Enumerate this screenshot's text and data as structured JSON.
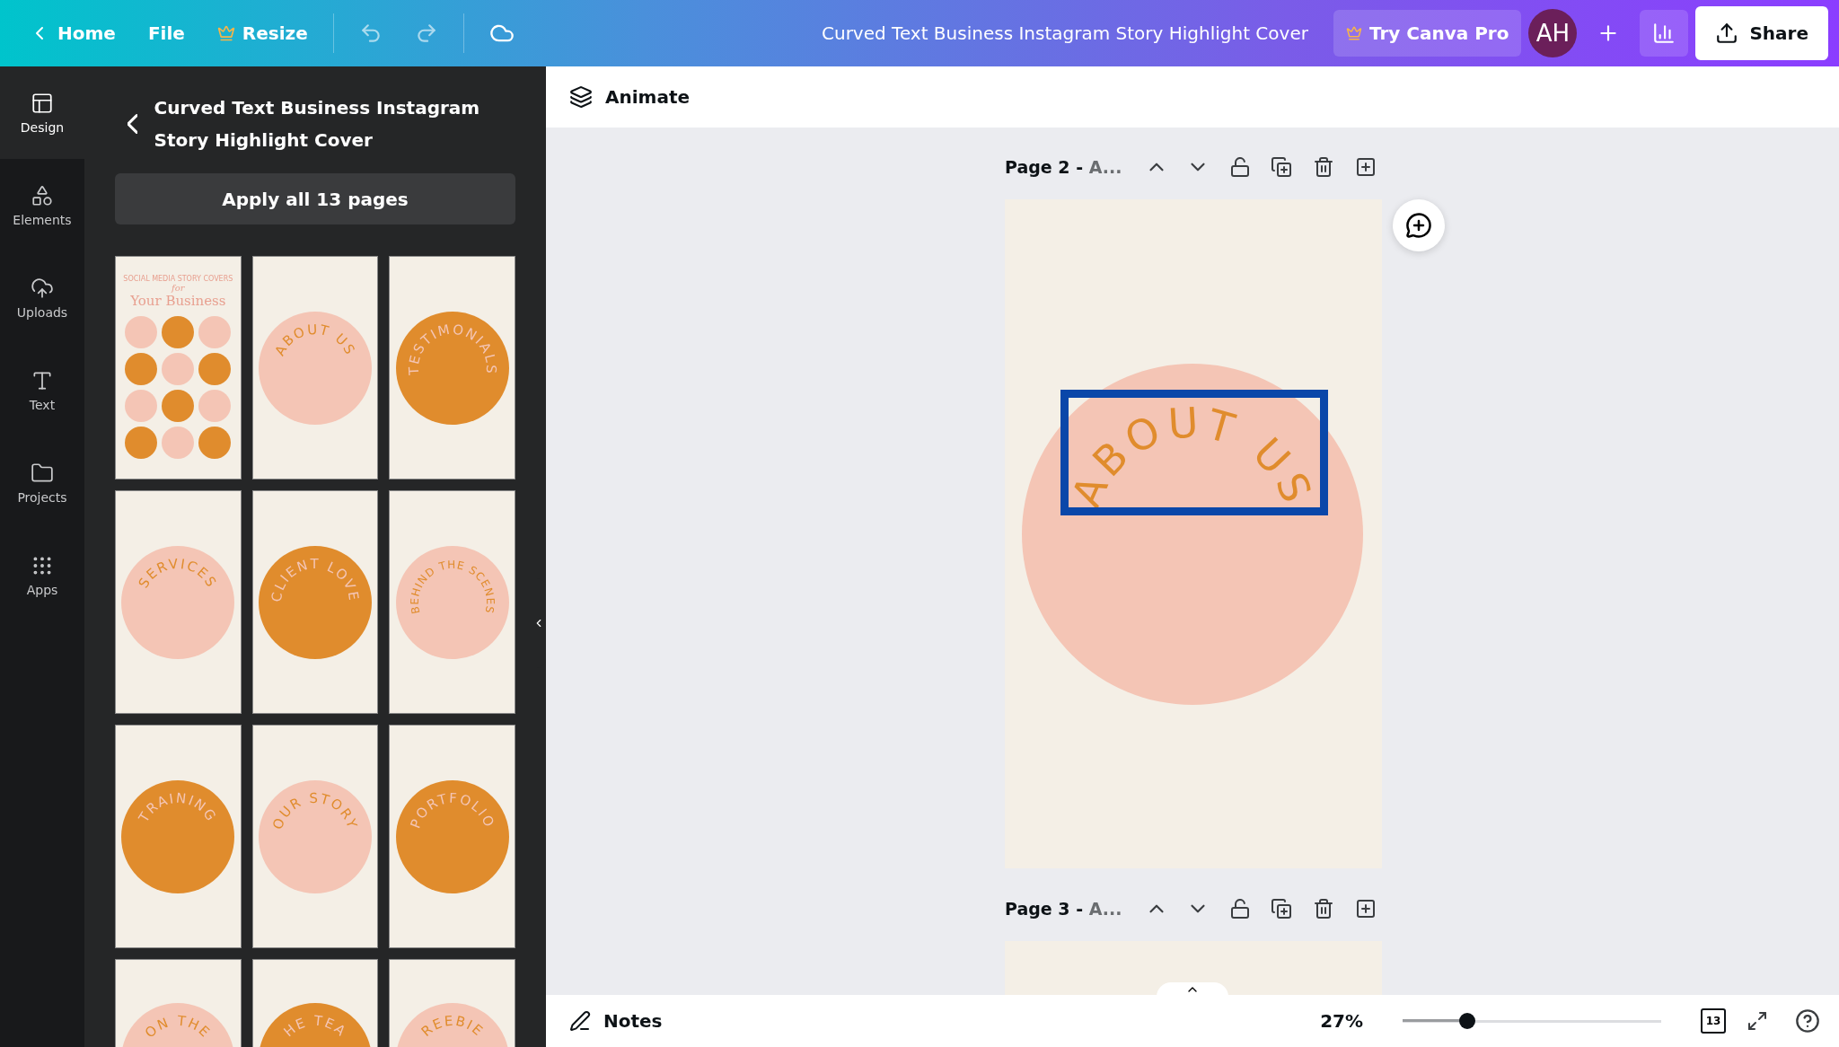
{
  "topbar": {
    "home": "Home",
    "file": "File",
    "resize": "Resize",
    "title": "Curved Text Business Instagram Story Highlight Cover",
    "pro": "Try Canva Pro",
    "avatar": "AH",
    "share": "Share"
  },
  "rail": [
    {
      "label": "Design",
      "selected": true
    },
    {
      "label": "Elements",
      "selected": false
    },
    {
      "label": "Uploads",
      "selected": false
    },
    {
      "label": "Text",
      "selected": false
    },
    {
      "label": "Projects",
      "selected": false
    },
    {
      "label": "Apps",
      "selected": false
    }
  ],
  "panel": {
    "title": "Curved Text Business Instagram Story Highlight Cover",
    "apply": "Apply all 13 pages",
    "cover": {
      "kicker": "SOCIAL MEDIA STORY COVERS",
      "script": "for",
      "heading": "Your Business",
      "circles": [
        {
          "color": "#f4c5b5"
        },
        {
          "color": "#e08c2d"
        },
        {
          "color": "#f4c5b5"
        },
        {
          "color": "#e08c2d"
        },
        {
          "color": "#f4c5b5"
        },
        {
          "color": "#e08c2d"
        },
        {
          "color": "#f4c5b5"
        },
        {
          "color": "#e08c2d"
        },
        {
          "color": "#f4c5b5"
        },
        {
          "color": "#e08c2d"
        },
        {
          "color": "#f4c5b5"
        },
        {
          "color": "#e08c2d"
        }
      ]
    },
    "thumbnails": [
      {
        "label": "ABOUT US",
        "color": "#f4c5b5"
      },
      {
        "label": "TESTIMONIALS",
        "color": "#e08c2d"
      },
      {
        "label": "SERVICES",
        "color": "#f4c5b5"
      },
      {
        "label": "CLIENT LOVE",
        "color": "#e08c2d"
      },
      {
        "label": "BEHIND THE SCENES",
        "color": "#f4c5b5"
      },
      {
        "label": "TRAINING",
        "color": "#e08c2d"
      },
      {
        "label": "OUR STORY",
        "color": "#f4c5b5"
      },
      {
        "label": "PORTFOLIO",
        "color": "#e08c2d"
      },
      {
        "label": "ON THE",
        "color": "#f4c5b5"
      },
      {
        "label": "HE TEA",
        "color": "#e08c2d"
      },
      {
        "label": "REEBIE",
        "color": "#f4c5b5"
      }
    ]
  },
  "animate": "Animate",
  "pages": [
    {
      "label": "Page 2 -",
      "name": "A..."
    },
    {
      "label": "Page 3 -",
      "name": "A..."
    }
  ],
  "design": {
    "label": "ABOUT US",
    "color": "#f4c5b5",
    "selected": true
  },
  "bottom": {
    "notes": "Notes",
    "zoom": "27%",
    "level": 0.25,
    "pages": "13"
  }
}
